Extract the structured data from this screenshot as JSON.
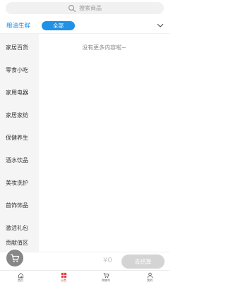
{
  "search": {
    "placeholder": "搜索商品"
  },
  "top_category": {
    "title": "粮油生鲜",
    "selected_chip": "全部"
  },
  "sidebar": {
    "items": [
      {
        "label": "家居百货"
      },
      {
        "label": "零食小吃"
      },
      {
        "label": "家用电器"
      },
      {
        "label": "家居家纺"
      },
      {
        "label": "保健养生"
      },
      {
        "label": "酒水饮品"
      },
      {
        "label": "美妆洗护"
      },
      {
        "label": "首饰饰品"
      },
      {
        "label": "激活礼包"
      },
      {
        "label": "贡献值区"
      }
    ]
  },
  "main": {
    "empty_message": "没有更多内容啦~"
  },
  "cart": {
    "price": "¥0",
    "checkout_label": "去结算"
  },
  "tabbar": {
    "tabs": [
      {
        "label": "首页",
        "icon": "home-icon",
        "active": false
      },
      {
        "label": "分类",
        "icon": "category-icon",
        "active": true
      },
      {
        "label": "购物车",
        "icon": "cart-icon",
        "active": false
      },
      {
        "label": "我的",
        "icon": "user-icon",
        "active": false
      }
    ]
  },
  "colors": {
    "accent": "#1f91e6",
    "active_tab": "#e63b3b",
    "sidebar_bg": "#f5f5f5",
    "checkout_bg": "#d4d4d4"
  }
}
